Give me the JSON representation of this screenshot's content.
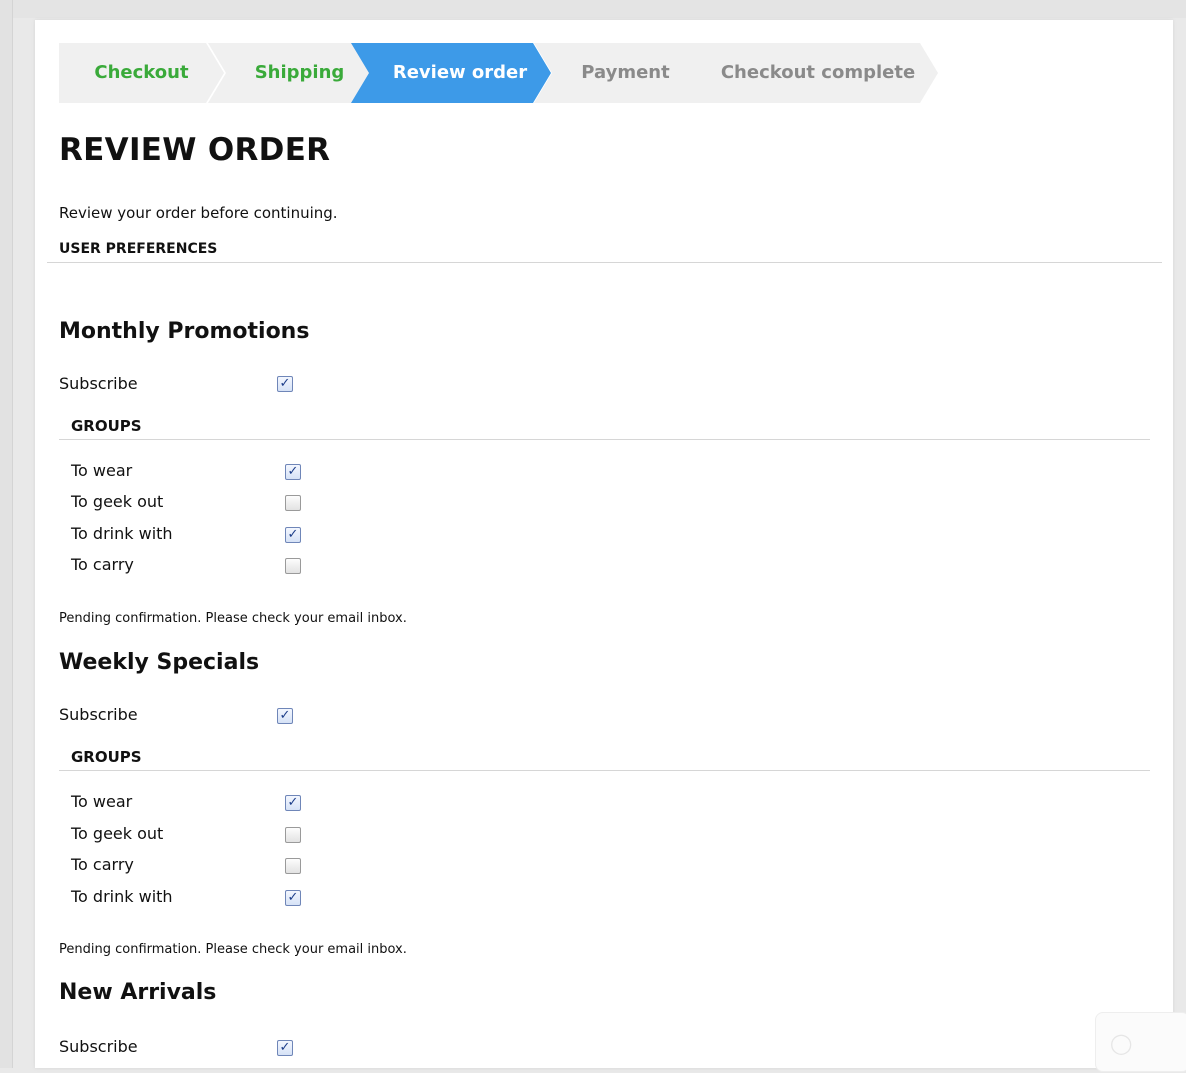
{
  "steps": [
    {
      "label": "Checkout",
      "state": "done"
    },
    {
      "label": "Shipping",
      "state": "done"
    },
    {
      "label": "Review order",
      "state": "current"
    },
    {
      "label": "Payment",
      "state": "todo"
    },
    {
      "label": "Checkout complete",
      "state": "todo"
    }
  ],
  "colors": {
    "step_done_text": "#3aaa3a",
    "step_current_bg": "#3d9ae8",
    "step_todo_text": "#8a8a8a"
  },
  "page": {
    "title": "REVIEW ORDER",
    "intro": "Review your order before continuing.",
    "prefs_heading": "USER PREFERENCES"
  },
  "sections": [
    {
      "title": "Monthly Promotions",
      "subscribe_label": "Subscribe",
      "subscribe_checked": true,
      "groups_heading": "GROUPS",
      "groups": [
        {
          "label": "To wear",
          "checked": true
        },
        {
          "label": "To geek out",
          "checked": false
        },
        {
          "label": "To drink with",
          "checked": true
        },
        {
          "label": "To carry",
          "checked": false
        }
      ],
      "pending": "Pending confirmation. Please check your email inbox."
    },
    {
      "title": "Weekly Specials",
      "subscribe_label": "Subscribe",
      "subscribe_checked": true,
      "groups_heading": "GROUPS",
      "groups": [
        {
          "label": "To wear",
          "checked": true
        },
        {
          "label": "To geek out",
          "checked": false
        },
        {
          "label": "To carry",
          "checked": false
        },
        {
          "label": "To drink with",
          "checked": true
        }
      ],
      "pending": "Pending confirmation. Please check your email inbox."
    },
    {
      "title": "New Arrivals",
      "subscribe_label": "Subscribe",
      "subscribe_checked": true
    }
  ],
  "chat_widget": {
    "icon": "chat-bubble-icon"
  }
}
